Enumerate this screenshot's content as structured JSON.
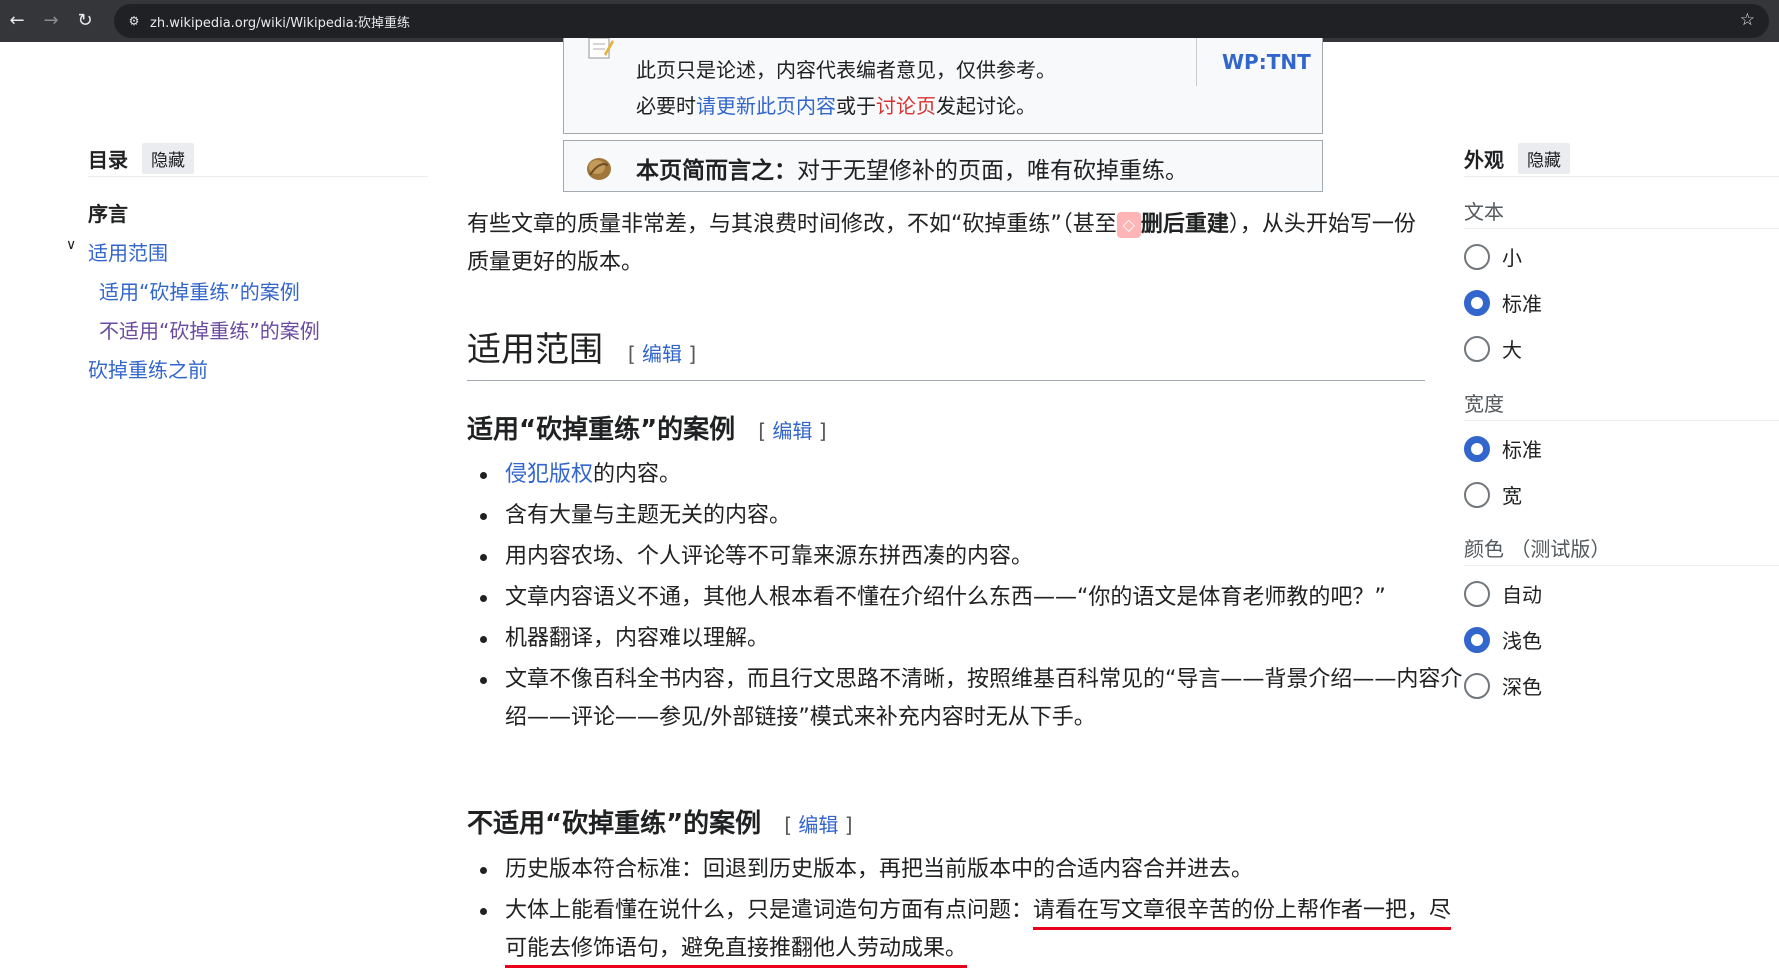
{
  "browser": {
    "url": "zh.wikipedia.org/wiki/Wikipedia:砍掉重练"
  },
  "toc": {
    "title": "目录",
    "hide_label": "隐藏",
    "items": [
      {
        "label": "序言"
      },
      {
        "label": "适用范围"
      },
      {
        "label": "适用“砍掉重练”的案例"
      },
      {
        "label": "不适用“砍掉重练”的案例"
      },
      {
        "label": "砍掉重练之前"
      }
    ]
  },
  "notice": {
    "line1": "此页只是论述，内容代表编者意见，仅供参考。",
    "line2_prefix": "必要时",
    "line2_link1": "请更新此页内容",
    "line2_mid": "或于",
    "line2_link2": "讨论页",
    "line2_suffix": "发起讨论。",
    "shortcut": "WP:TNT"
  },
  "nutshell": {
    "label": "本页简而言之：",
    "text": "对于无望修补的页面，唯有砍掉重练。"
  },
  "intro": {
    "part1": "有些文章的质量非常差，与其浪费时间修改，不如“砍掉重练”（甚至",
    "badge": "◇",
    "bold": "删后重建",
    "part2": "），从头开始写一份质量更好的版本。"
  },
  "section_scope": {
    "title": "适用范围",
    "edit_open": "[",
    "edit_label": "编辑",
    "edit_close": "]"
  },
  "section_apply": {
    "title": "适用“砍掉重练”的案例",
    "edit_label": "编辑",
    "items": [
      {
        "link": "侵犯版权",
        "text": "的内容。"
      },
      {
        "text": "含有大量与主题无关的内容。"
      },
      {
        "text": "用内容农场、个人评论等不可靠来源东拼西凑的内容。"
      },
      {
        "text": "文章内容语义不通，其他人根本看不懂在介绍什么东西——“你的语文是体育老师教的吧？”"
      },
      {
        "text": "机器翻译，内容难以理解。"
      },
      {
        "text": "文章不像百科全书内容，而且行文思路不清晰，按照维基百科常见的“导言——背景介绍——内容介绍——评论——参见/外部链接”模式来补充内容时无从下手。"
      }
    ]
  },
  "section_not_apply": {
    "title": "不适用“砍掉重练”的案例",
    "edit_label": "编辑",
    "items": [
      {
        "text": "历史版本符合标准：回退到历史版本，再把当前版本中的合适内容合并进去。"
      },
      {
        "text_plain": "大体上能看懂在说什么，只是遣词造句方面有点问题：",
        "text_underlined": "请看在写文章很辛苦的份上帮作者一把，尽可能去修饰语句，避免直接推翻他人劳动成果。"
      }
    ]
  },
  "appearance": {
    "title": "外观",
    "hide_label": "隐藏",
    "text_group": {
      "label": "文本",
      "options": [
        "小",
        "标准",
        "大"
      ],
      "selected": "标准"
    },
    "width_group": {
      "label": "宽度",
      "options": [
        "标准",
        "宽"
      ],
      "selected": "标准"
    },
    "color_group": {
      "label": "颜色 （测试版）",
      "options": [
        "自动",
        "浅色",
        "深色"
      ],
      "selected": "浅色"
    }
  },
  "colors": {
    "link": "#3366cc",
    "red_link": "#d73333",
    "underline_annotation": "#e8001a",
    "radio_selected": "#3366cc"
  }
}
